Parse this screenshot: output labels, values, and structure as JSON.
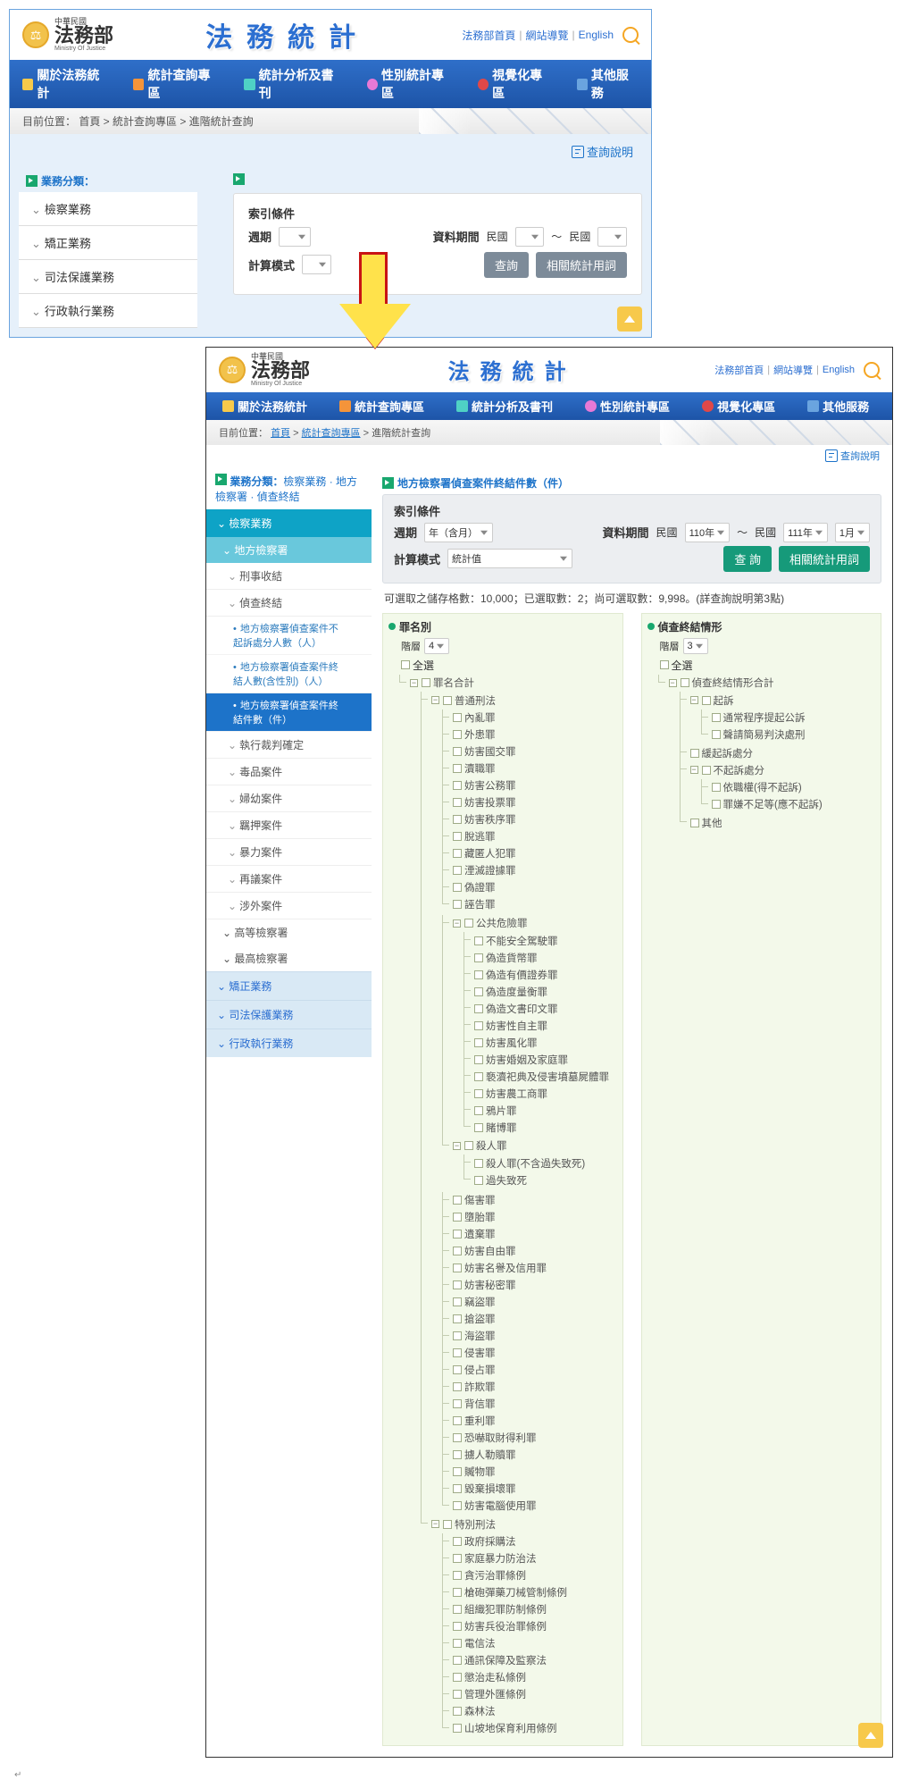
{
  "common": {
    "logo_small": "中華民國",
    "logo_main": "法務部",
    "logo_sub": "Ministry Of Justice",
    "site_title": "法務統計",
    "hdr_links": {
      "home": "法務部首頁",
      "sitemap": "網站導覽",
      "english": "English"
    },
    "nav": {
      "n1": "關於法務統計",
      "n2": "統計查詢專區",
      "n3": "統計分析及書刊",
      "n4": "性別統計專區",
      "n5": "視覺化專區",
      "n6": "其他服務"
    },
    "help": "查詢說明",
    "era": "民國",
    "btn_query": "查 詢",
    "btn_related": "相關統計用詞",
    "chev": "⌄"
  },
  "frame1": {
    "breadcrumb": "目前位置： 首頁 > 統計查詢專區 > 進階統計查詢",
    "cat_label": "業務分類：",
    "cats": {
      "c1": "檢察業務",
      "c2": "矯正業務",
      "c3": "司法保護業務",
      "c4": "行政執行業務"
    },
    "panel": {
      "title": "索引條件",
      "period": "週期",
      "data_range": "資料期間",
      "to": "～",
      "calc": "計算模式",
      "btn_query": "查詢"
    }
  },
  "frame2": {
    "breadcrumb_pre": "目前位置：",
    "bc": {
      "home": "首頁",
      "sec": "統計查詢專區",
      "page": "進階統計查詢"
    },
    "cat_strip_label": "業務分類：",
    "cat_strip_path": "檢察業務 · 地方檢察署 · 偵查終結",
    "section_title": "地方檢察署偵查案件終結件數（件）",
    "side": {
      "s_head": "檢察業務",
      "s_sub1": "地方檢察署",
      "l2_a": "刑事收結",
      "l2_b": "偵查終結",
      "lk1": "地方檢察署偵查案件不起訴處分人數（人）",
      "lk2": "地方檢察署偵查案件終結人數(含性別)（人）",
      "lk3": "地方檢察署偵查案件終結件數（件）",
      "l2_c": "執行裁判確定",
      "l2_d": "毒品案件",
      "l2_e": "婦幼案件",
      "l2_f": "羈押案件",
      "l2_g": "暴力案件",
      "l2_h": "再議案件",
      "l2_i": "涉外案件",
      "s_sub2": "高等檢察署",
      "s_sub3": "最高檢察署",
      "g2": "矯正業務",
      "g3": "司法保護業務",
      "g4": "行政執行業務"
    },
    "panel": {
      "title": "索引條件",
      "period": "週期",
      "period_val": "年（含月）",
      "data_range": "資料期間",
      "y1": "110年",
      "y2": "111年",
      "m2": "1月",
      "to": "～",
      "calc": "計算模式",
      "calc_val": "統計值"
    },
    "quota": "可選取之儲存格數：10,000；已選取數：2；尚可選取數：9,998。(詳查詢說明第3點)",
    "treeA": {
      "head": "罪名別",
      "level_lab": "階層",
      "level_val": "4",
      "all": "全選",
      "h1": "罪名合計",
      "h2": "普通刑法",
      "items1": [
        "內亂罪",
        "外患罪",
        "妨害國交罪",
        "瀆職罪",
        "妨害公務罪",
        "妨害投票罪",
        "妨害秩序罪",
        "脫逃罪",
        "藏匿人犯罪",
        "湮滅證據罪",
        "偽證罪",
        "誣告罪"
      ],
      "h3": "公共危險罪",
      "h3items": [
        "不能安全駕駛罪",
        "偽造貨幣罪",
        "偽造有價證券罪",
        "偽造度量衡罪",
        "偽造文書印文罪",
        "妨害性自主罪",
        "妨害風化罪",
        "妨害婚姻及家庭罪",
        "褻瀆祀典及侵害墳墓屍體罪",
        "妨害農工商罪",
        "鴉片罪",
        "賭博罪"
      ],
      "h4": "殺人罪",
      "h4items": [
        "殺人罪(不含過失致死)",
        "過失致死"
      ],
      "items2": [
        "傷害罪",
        "墮胎罪",
        "遺棄罪",
        "妨害自由罪",
        "妨害名譽及信用罪",
        "妨害秘密罪",
        "竊盜罪",
        "搶盜罪",
        "海盜罪",
        "侵害罪",
        "侵占罪",
        "詐欺罪",
        "背信罪",
        "重利罪",
        "恐嚇取財得利罪",
        "擄人勒贖罪",
        "贓物罪",
        "毀棄損壞罪",
        "妨害電腦使用罪"
      ],
      "h5": "特別刑法",
      "items3": [
        "政府採購法",
        "家庭暴力防治法",
        "貪污治罪條例",
        "槍砲彈藥刀械管制條例",
        "組織犯罪防制條例",
        "妨害兵役治罪條例",
        "電信法",
        "通訊保障及監察法",
        "懲治走私條例",
        "管理外匯條例",
        "森林法",
        "山坡地保育利用條例"
      ]
    },
    "treeB": {
      "head": "偵查終結情形",
      "level_lab": "階層",
      "level_val": "3",
      "all": "全選",
      "h1": "偵查終結情形合計",
      "h2": "起訴",
      "h2items": [
        "通常程序提起公訴",
        "聲請簡易判決處刑"
      ],
      "i1": "緩起訴處分",
      "h3": "不起訴處分",
      "h3items": [
        "依職權(得不起訴)",
        "罪嫌不足等(應不起訴)"
      ],
      "i2": "其他"
    }
  },
  "footer_marker": "↵"
}
